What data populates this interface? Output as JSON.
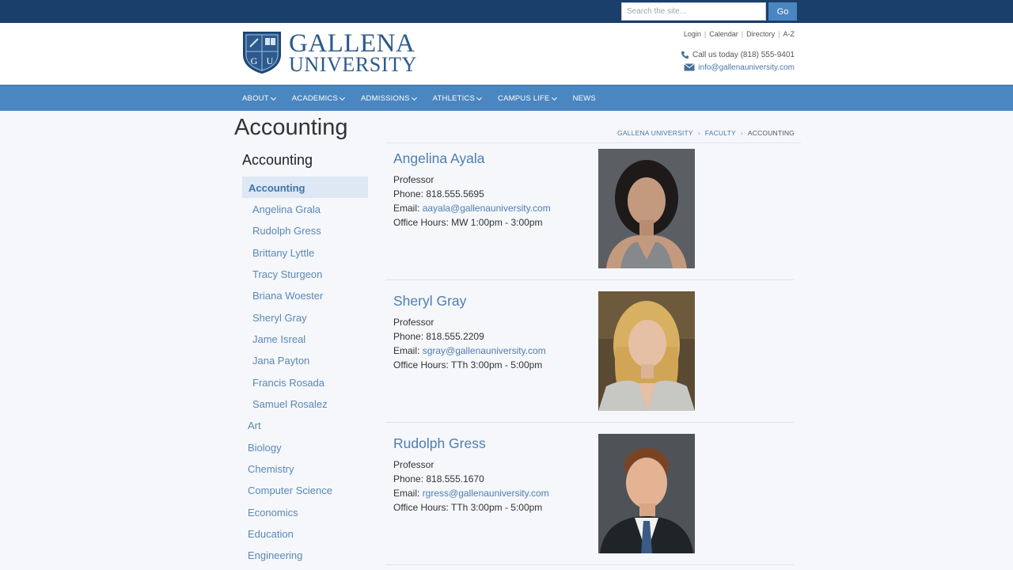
{
  "topbar": {
    "search_placeholder": "Search the site...",
    "go_label": "Go"
  },
  "header": {
    "logo_line1": "GALLENA",
    "logo_line2": "UNIVERSITY",
    "shield_letters": [
      "G",
      "U"
    ],
    "util_links": [
      "Login",
      "Calendar",
      "Directory",
      "A-Z"
    ],
    "phone_text": "Call us today (818) 555-9401",
    "email_text": "info@gallenauniversity.com"
  },
  "nav": {
    "items": [
      {
        "label": "ABOUT",
        "has_dropdown": true
      },
      {
        "label": "ACADEMICS",
        "has_dropdown": true
      },
      {
        "label": "ADMISSIONS",
        "has_dropdown": true
      },
      {
        "label": "ATHLETICS",
        "has_dropdown": true
      },
      {
        "label": "CAMPUS LIFE",
        "has_dropdown": true
      },
      {
        "label": "NEWS",
        "has_dropdown": false
      }
    ]
  },
  "page": {
    "title": "Accounting",
    "breadcrumb": [
      "GALLENA UNIVERSITY",
      "FACULTY",
      "ACCOUNTING"
    ]
  },
  "sidebar": {
    "title": "Accounting",
    "active": "Accounting",
    "subitems": [
      "Angelina Grala",
      "Rudolph Gress",
      "Brittany Lyttle",
      "Tracy Sturgeon",
      "Briana Woester",
      "Sheryl Gray",
      "Jame Isreal",
      "Jana Payton",
      "Francis Rosada",
      "Samuel Rosalez"
    ],
    "departments": [
      "Art",
      "Biology",
      "Chemistry",
      "Computer Science",
      "Economics",
      "Education",
      "Engineering"
    ]
  },
  "faculty": [
    {
      "name": "Angelina Ayala",
      "title": "Professor",
      "phone_label": "Phone: ",
      "phone": "818.555.5695",
      "email_label": "Email: ",
      "email": "aayala@gallenauniversity.com",
      "hours_label": "Office Hours: ",
      "hours": "MW 1:00pm - 3:00pm"
    },
    {
      "name": "Sheryl Gray",
      "title": "Professor",
      "phone_label": "Phone: ",
      "phone": "818.555.2209",
      "email_label": "Email: ",
      "email": "sgray@gallenauniversity.com",
      "hours_label": "Office Hours: ",
      "hours": "TTh 3:00pm - 5:00pm"
    },
    {
      "name": "Rudolph Gress",
      "title": "Professor",
      "phone_label": "Phone: ",
      "phone": "818.555.1670",
      "email_label": "Email: ",
      "email": "rgress@gallenauniversity.com",
      "hours_label": "Office Hours: ",
      "hours": "TTh 3:00pm - 5:00pm"
    }
  ],
  "colors": {
    "topbar": "#1b3f6b",
    "nav": "#4a86c0",
    "brand": "#2c5a8c",
    "link": "#4d7eb0"
  }
}
